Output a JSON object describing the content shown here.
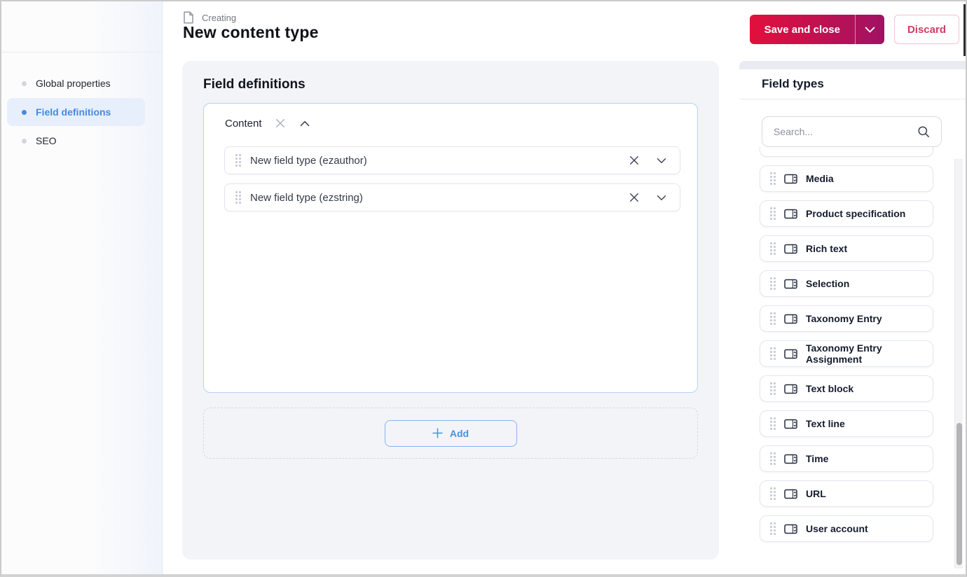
{
  "header": {
    "kicker": "Creating",
    "title": "New content type",
    "save_label": "Save and close",
    "discard_label": "Discard"
  },
  "sidebar": {
    "items": [
      {
        "label": "Global properties",
        "active": false
      },
      {
        "label": "Field definitions",
        "active": true
      },
      {
        "label": "SEO",
        "active": false
      }
    ]
  },
  "main": {
    "section_title": "Field definitions",
    "group": {
      "name": "Content",
      "fields": [
        {
          "label": "New field type (ezauthor)"
        },
        {
          "label": "New field type (ezstring)"
        }
      ]
    },
    "add_label": "Add"
  },
  "field_types_panel": {
    "title": "Field types",
    "search_placeholder": "Search...",
    "items": [
      "Media",
      "Product specification",
      "Rich text",
      "Selection",
      "Taxonomy Entry",
      "Taxonomy Entry Assignment",
      "Text block",
      "Text line",
      "Time",
      "URL",
      "User account"
    ]
  },
  "icons": {
    "document": "page outline with folded corner",
    "close": "✕",
    "chevron_down": "⌄",
    "chevron_up": "⌃",
    "plus": "+",
    "search": "magnifier",
    "drag_handle": "⠿",
    "field_type": "input box with stepper"
  },
  "colors": {
    "accent_gradient_start": "#e2103c",
    "accent_gradient_end": "#a01264",
    "discard_text": "#d23c64",
    "active_blue": "#4a90e2",
    "active_blue_bg": "#e7effc",
    "panel_gray": "#f3f4f7",
    "group_border_blue": "#b7d2f0"
  }
}
